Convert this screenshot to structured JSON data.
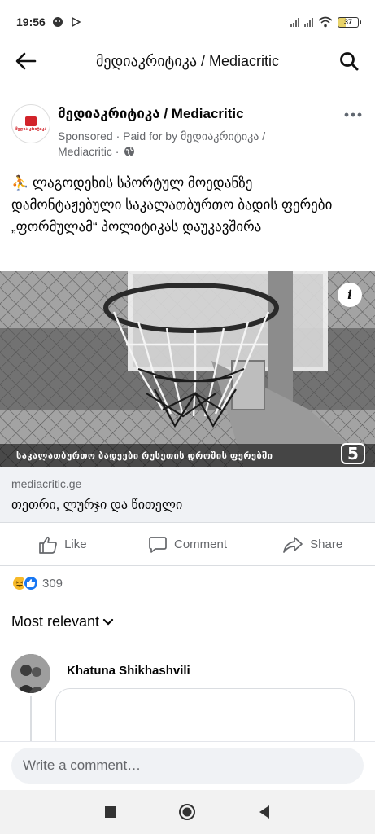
{
  "status_bar": {
    "time": "19:56",
    "battery": "37"
  },
  "header": {
    "title": "მედიაკრიტიკა / Mediacritic"
  },
  "post": {
    "page_name": "მედიაკრიტიკა / Mediacritic",
    "sponsored_line": "Sponsored · Paid for by მედიაკრიტიკა / Mediacritic ·",
    "avatar_logo_text": "მედია კრიტიკა",
    "emoji": "⛹",
    "text": "ლაგოდეხის სპორტულ მოედანზე დამონტაჟებული საკალათბურთო ბადის ფერები „ფორმულამ“ პოლიტიკას დაუკავშირა",
    "image": {
      "caption": "საკალათბურთო ბადეები რუსეთის დროშის ფერებში",
      "channel_logo": "5",
      "info_label": "i"
    },
    "link": {
      "domain": "mediacritic.ge",
      "title": "თეთრი, ლურჯი და წითელი"
    },
    "actions": {
      "like": "Like",
      "comment": "Comment",
      "share": "Share"
    },
    "reaction_count": "309"
  },
  "comments": {
    "sort_label": "Most relevant",
    "items": [
      {
        "author": "Khatuna Shikhashvili"
      }
    ]
  },
  "composer": {
    "placeholder": "Write a comment…"
  },
  "colors": {
    "brand_blue": "#1877f2",
    "secondary_text": "#65676b",
    "logo_red": "#d2232a",
    "haha_yellow": "#f7b928"
  }
}
